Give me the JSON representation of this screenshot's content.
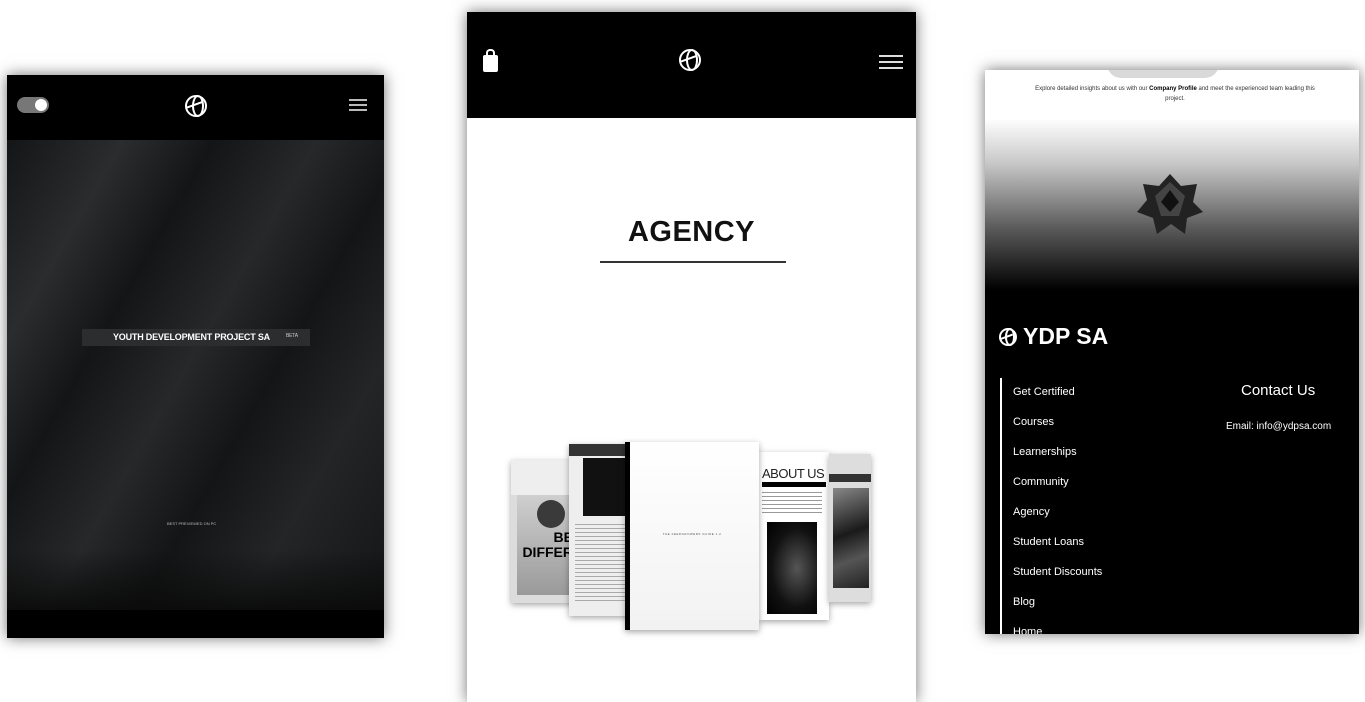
{
  "left_screen": {
    "badge_text": "YOUTH DEVELOPMENT PROJECT SA",
    "badge_tag": "BETA",
    "footer_tiny": "BEST PREVIEWED ON PC"
  },
  "middle_screen": {
    "heading": "AGENCY",
    "cards": {
      "card1_text": "BE DIFFER",
      "center_text": "THE FEEDGROWERS GUIDE 1.2",
      "about": "ABOUT US"
    }
  },
  "right_screen": {
    "intro_pre": "Explore detailed insights about us with our ",
    "intro_bold": "Company Profile",
    "intro_post": " and meet the experienced team leading this project.",
    "brand": "YDP SA",
    "nav": [
      "Get Certified",
      "Courses",
      "Learnerships",
      "Community",
      "Agency",
      "Student Loans",
      "Student Discounts",
      "Blog",
      "Home"
    ],
    "contact_heading": "Contact Us",
    "contact_email": "Email: info@ydpsa.com"
  },
  "colors": {
    "dark": "#000000",
    "hero": "#1c1e20",
    "accent": "#ffffff"
  }
}
